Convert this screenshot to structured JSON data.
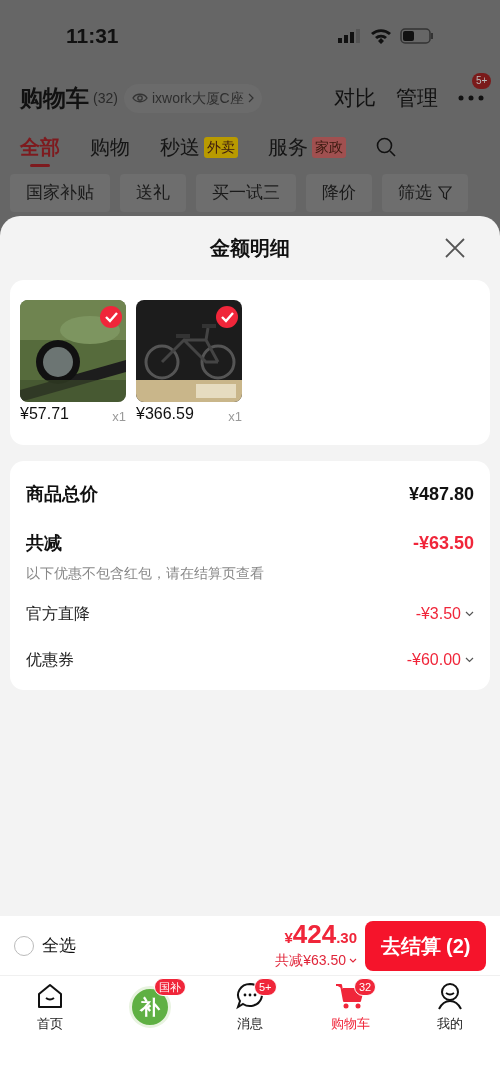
{
  "status_bar": {
    "time": "11:31"
  },
  "header": {
    "title": "购物车",
    "count": "(32)",
    "location": "ixwork大厦C座",
    "actions": [
      "对比",
      "管理"
    ],
    "more_badge": "5+"
  },
  "tabs": [
    {
      "label": "全部",
      "selected": true
    },
    {
      "label": "购物",
      "selected": false
    },
    {
      "label": "秒送",
      "tag": "外卖",
      "selected": false
    },
    {
      "label": "服务",
      "tag": "家政",
      "selected": false
    }
  ],
  "filters": [
    {
      "label": "国家补贴",
      "kind": "chip"
    },
    {
      "label": "送礼",
      "kind": "chip"
    },
    {
      "label": "买一试三",
      "kind": "chip"
    },
    {
      "label": "降价",
      "kind": "chip"
    },
    {
      "label": "筛选",
      "kind": "filter"
    }
  ],
  "sheet": {
    "title": "金额明细",
    "items": [
      {
        "kind": "picture",
        "price": "¥57.71",
        "qty": "x1",
        "checked": true
      },
      {
        "kind": "picture",
        "price": "¥366.59",
        "qty": "x1",
        "checked": true
      }
    ],
    "total": {
      "label": "商品总价",
      "value": "¥487.80"
    },
    "reduction": {
      "label": "共减",
      "value": "-¥63.50",
      "note": "以下优惠不包含红包，请在结算页查看"
    },
    "discounts": [
      {
        "label": "官方直降",
        "value": "-¥3.50"
      },
      {
        "label": "优惠券",
        "value": "-¥60.00"
      }
    ]
  },
  "checkout": {
    "select_all": {
      "label": "全选",
      "checked": false
    },
    "currency": "¥",
    "amount": "424",
    "decimal": ".30",
    "reduction": "共减¥63.50",
    "button": "去结算 (2)"
  },
  "nav": [
    {
      "kind": "home",
      "label": "首页",
      "selected": false
    },
    {
      "kind": "subsidy",
      "icon_text": "补",
      "badge": "国补",
      "selected": false
    },
    {
      "kind": "message",
      "label": "消息",
      "badge": "5+",
      "selected": false
    },
    {
      "kind": "cart",
      "label": "购物车",
      "badge": "32",
      "selected": true
    },
    {
      "kind": "profile",
      "label": "我的",
      "selected": false
    }
  ]
}
